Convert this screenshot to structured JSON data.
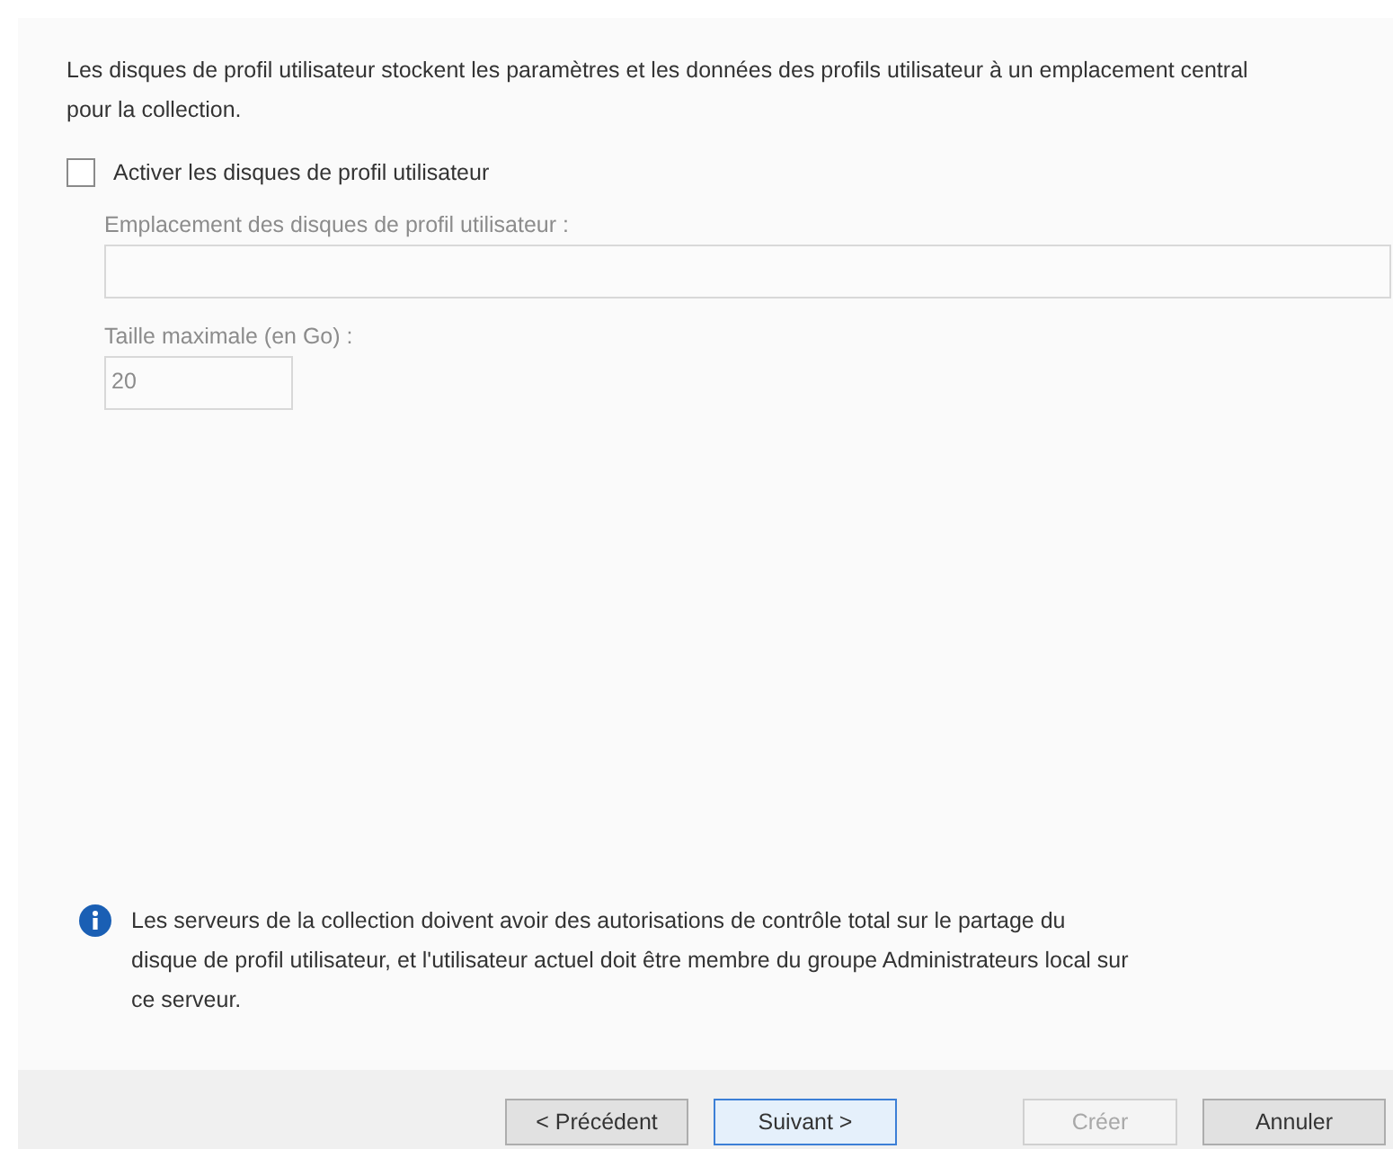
{
  "description": "Les disques de profil utilisateur stockent les paramètres et les données des profils utilisateur à un emplacement central pour la collection.",
  "enable_checkbox": {
    "label": "Activer les disques de profil utilisateur",
    "checked": false
  },
  "fields": [
    {
      "label": "Emplacement des disques de profil utilisateur :",
      "disabled": true,
      "kind": "wide"
    },
    {
      "label": "Taille maximale (en Go) :",
      "value": "20",
      "disabled": true,
      "kind": "narrow"
    }
  ],
  "info_message": "Les serveurs de la collection doivent avoir des autorisations de contrôle total sur le partage du disque de profil utilisateur, et l'utilisateur actuel doit être membre du groupe Administrateurs local sur ce serveur.",
  "buttons": [
    {
      "label": "< Précédent",
      "disabled": false,
      "default": false
    },
    {
      "label": "Suivant >",
      "disabled": false,
      "default": true
    },
    {
      "label": "Créer",
      "disabled": true,
      "default": false
    },
    {
      "label": "Annuler",
      "disabled": false,
      "default": false
    }
  ]
}
